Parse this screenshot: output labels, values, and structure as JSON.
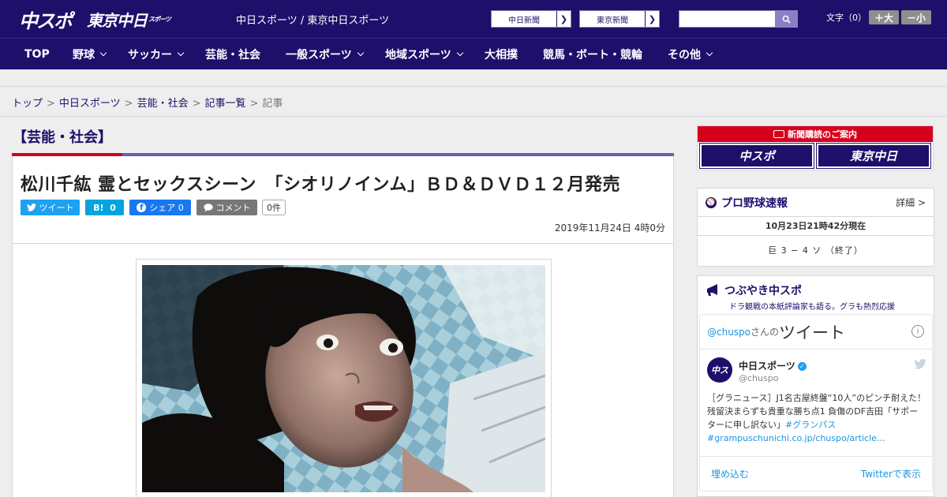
{
  "header": {
    "logo_chuspo": "中スポ",
    "logo_tokyo": "東京中日",
    "logo_tokyo_sub": "スポーツ",
    "title": "中日スポーツ / 東京中日スポーツ",
    "btn_chunichi": "中日新聞",
    "btn_tokyo": "東京新聞",
    "search_placeholder": "",
    "fontsize_label": "文字（0）",
    "font_increase": "＋大",
    "font_decrease": "－小"
  },
  "nav": {
    "items": [
      "TOP",
      "野球",
      "サッカー",
      "芸能・社会",
      "一般スポーツ",
      "地域スポーツ",
      "大相撲",
      "競馬・ボート・競輪",
      "その他"
    ]
  },
  "breadcrumb": {
    "items": [
      "トップ",
      "中日スポーツ",
      "芸能・社会",
      "記事一覧"
    ],
    "current": "記事"
  },
  "article": {
    "category": "【芸能・社会】",
    "headline": "松川千紘 霊とセックスシーン　「シオリノインム」ＢＤ＆ＤＶＤ１２月発売",
    "tweet_label": "ツイート",
    "hatena_label": "B!",
    "hatena_count": "0",
    "share_label": "シェア",
    "share_count": "0",
    "comment_label": "コメント",
    "comment_count": "0件",
    "date": "2019年11月24日 4時0分"
  },
  "sidebar": {
    "subscribe_title": "新聞購読のご案内",
    "subscribe_logo1": "中スポ",
    "subscribe_logo2": "東京中日",
    "baseball": {
      "title": "プロ野球速報",
      "detail": "詳細 >",
      "time": "10月23日21時42分現在",
      "score": "巨 3 − 4 ソ （終了）"
    },
    "tsubuyaki": {
      "title": "つぶやき中スポ",
      "sub": "ドラ観戦の本紙評論家も語る。グラも熱烈応援",
      "widget_handle": "@chuspo",
      "widget_san": "さんの",
      "widget_tweet": "ツイート",
      "account_name": "中日スポーツ",
      "account_handle": "@chuspo",
      "tweet_text": "［グラニュース］J1名古屋終盤“10人”のピンチ耐えた！残留決まらずも貴重な勝ち点1 負傷のDF吉田「サポーターに申し訳ない」",
      "tweet_hashtag": "#グランパス",
      "tweet_link": "#grampuschunichi.co.jp/chuspo/article…",
      "embed": "埋め込む",
      "view_on_twitter": "Twitterで表示"
    }
  },
  "colors": {
    "brand": "#1e0f6b",
    "accent_red": "#d6001c",
    "twitter": "#1da1f2"
  }
}
